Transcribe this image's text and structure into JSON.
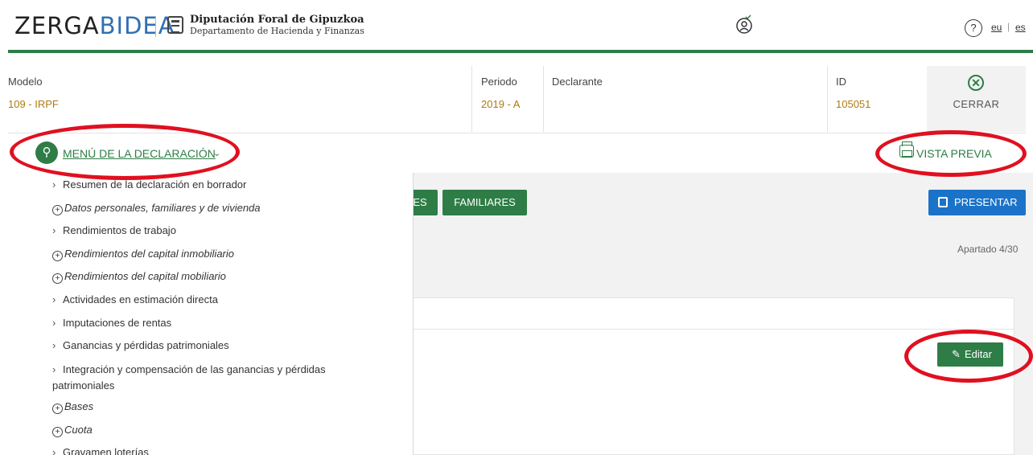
{
  "header": {
    "logo_main": "ZERGA",
    "logo_accent": "BIDEA",
    "org_name": "Diputación Foral de Gipuzkoa",
    "org_dept": "Departamento de Hacienda y Finanzas",
    "help_symbol": "?",
    "lang_eu": "eu",
    "lang_es": "es",
    "icons": [
      "user-circle-icon",
      "help-icon",
      "coat-of-arms-icon"
    ]
  },
  "declaration": {
    "model_label": "Modelo",
    "model_value": "109 - IRPF",
    "period_label": "Periodo",
    "period_value": "2019 - A",
    "declarant_label": "Declarante",
    "declarant_value": "",
    "id_label": "ID",
    "id_value": "105051",
    "close_label": "CERRAR",
    "close_symbol": "✕"
  },
  "menu": {
    "label": "MENÚ DE LA DECLARACIÓN",
    "preview_label": "VISTA PREVIA",
    "items": [
      {
        "label": "Resumen de la declaración en borrador",
        "kind": "leaf"
      },
      {
        "label": "Datos personales, familiares y de vivienda",
        "kind": "group"
      },
      {
        "label": "Rendimientos de trabajo",
        "kind": "leaf"
      },
      {
        "label": "Rendimientos del capital inmobiliario",
        "kind": "group"
      },
      {
        "label": "Rendimientos del capital mobiliario",
        "kind": "group"
      },
      {
        "label": "Actividades en estimación directa",
        "kind": "leaf"
      },
      {
        "label": "Imputaciones de rentas",
        "kind": "leaf"
      },
      {
        "label": "Ganancias y pérdidas patrimoniales",
        "kind": "leaf"
      },
      {
        "label": "Integración y compensación de las ganancias y pérdidas patrimoniales",
        "kind": "leaf"
      },
      {
        "label": "Bases",
        "kind": "group"
      },
      {
        "label": "Cuota",
        "kind": "group"
      },
      {
        "label": "Gravamen loterías",
        "kind": "leaf"
      }
    ]
  },
  "content": {
    "tab_partial": "ES",
    "tab_familiares": "FAMILIARES",
    "present_label": "PRESENTAR",
    "apartado": "Apartado 4/30",
    "edit_label": "Editar",
    "edit_symbol": "✎"
  },
  "colors": {
    "brand_green": "#2e7d46",
    "present_blue": "#1a73c9",
    "value_gold": "#b07a12",
    "annotation_red": "#e01020"
  }
}
